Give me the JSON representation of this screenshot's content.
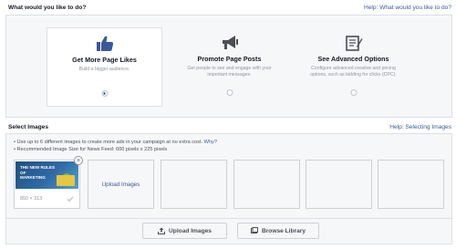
{
  "objective": {
    "heading": "What would you like to do?",
    "help_link": "Help: What would you like to do?",
    "options": [
      {
        "title": "Get More Page Likes",
        "description": "Build a bigger audience.",
        "icon": "thumbs-up-icon",
        "selected": true
      },
      {
        "title": "Promote Page Posts",
        "description": "Get people to see and engage with your important messages.",
        "icon": "megaphone-icon",
        "selected": false
      },
      {
        "title": "See Advanced Options",
        "description": "Configure advanced creative and pricing options, such as bidding for clicks (CPC).",
        "icon": "notepad-icon",
        "selected": false
      }
    ]
  },
  "images": {
    "heading": "Select Images",
    "help_link": "Help: Selecting Images",
    "notes": {
      "line1": "• Use up to 6 different images to create more ads in your campaign at no extra cost.",
      "why": "Why?",
      "line2": "• Recommended Image Size for News Feed: 600 pixels x 225 pixels"
    },
    "thumbnail": {
      "text_line1": "THE NEW RULES",
      "text_line2": "OF",
      "text_line3": "MARKETING",
      "size": "850 × 313"
    },
    "upload_slot_label": "Upload Images",
    "buttons": {
      "upload": "Upload Images",
      "browse": "Browse Library"
    }
  },
  "colors": {
    "link": "#3b5998",
    "panel_bg": "#f6f7f9",
    "border": "#dddfe2",
    "muted_text": "#90949c"
  }
}
